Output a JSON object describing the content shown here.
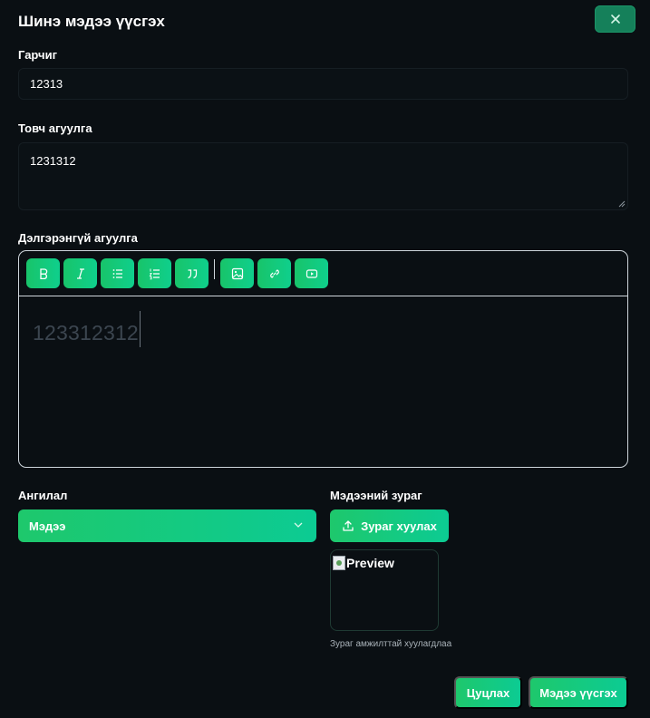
{
  "modal": {
    "title": "Шинэ мэдээ үүсгэх",
    "close_icon": "close-icon"
  },
  "title_field": {
    "label": "Гарчиг",
    "value": "12313"
  },
  "summary_field": {
    "label": "Товч агуулга",
    "value": "1231312"
  },
  "content_field": {
    "label": "Дэлгэрэнгүй агуулга",
    "value": "123312312",
    "toolbar": [
      {
        "name": "bold-icon"
      },
      {
        "name": "italic-icon"
      },
      {
        "name": "bullet-list-icon"
      },
      {
        "name": "ordered-list-icon"
      },
      {
        "name": "quote-icon"
      },
      {
        "name": "image-icon"
      },
      {
        "name": "link-icon"
      },
      {
        "name": "video-icon"
      }
    ]
  },
  "category": {
    "label": "Ангилал",
    "selected": "Мэдээ"
  },
  "news_image": {
    "label": "Мэдээний зураг",
    "upload_label": "Зураг хуулах",
    "preview_alt": "Preview",
    "status": "Зураг амжилттай хуулагдлаа"
  },
  "actions": {
    "cancel_label": "Цуцлах",
    "create_label": "Мэдээ үүсгэх"
  },
  "colors": {
    "background": "#0a0f13",
    "accent_start": "#1ec86c",
    "accent_end": "#0ccb93",
    "close_button": "#15805a"
  }
}
